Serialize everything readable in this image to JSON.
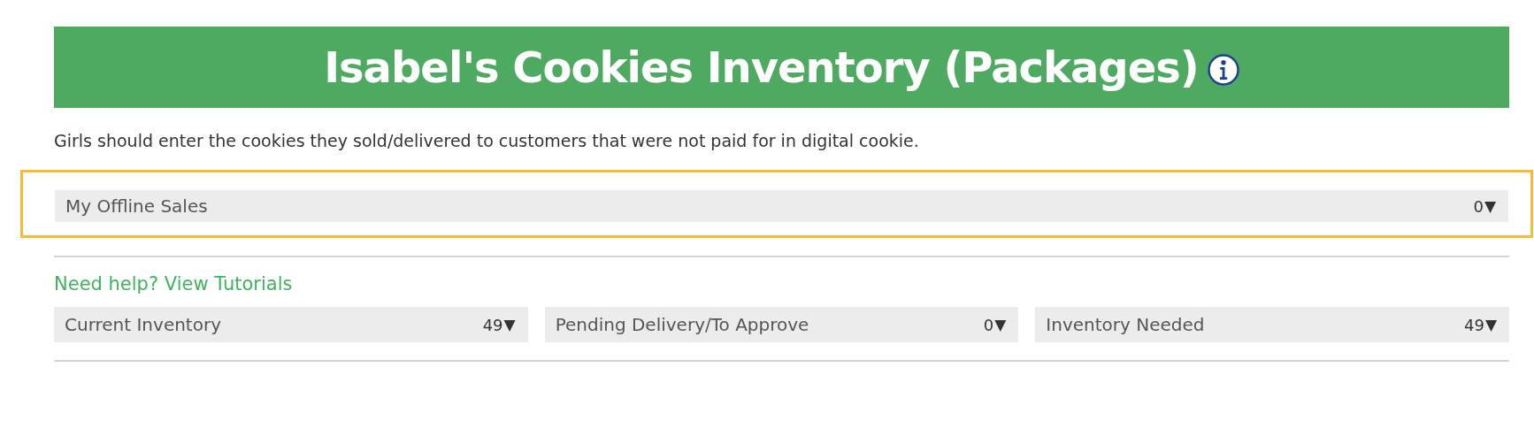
{
  "header": {
    "title": "Isabel's Cookies Inventory (Packages)"
  },
  "description": "Girls should enter the cookies they sold/delivered to customers that were not paid for in digital cookie.",
  "offline_sales": {
    "label": "My Offline Sales",
    "value": "0",
    "caret": "▼",
    "highlighted": true
  },
  "help_link": "Need help? View Tutorials",
  "summaries": [
    {
      "label": "Current Inventory",
      "value": "49",
      "caret": "▼"
    },
    {
      "label": "Pending Delivery∕To Approve",
      "value": "0",
      "caret": "▼"
    },
    {
      "label": "Inventory Needed",
      "value": "49",
      "caret": "▼"
    }
  ]
}
